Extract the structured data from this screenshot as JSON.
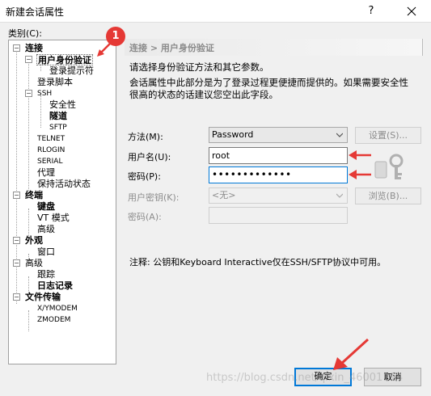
{
  "window": {
    "title": "新建会话属性",
    "help_glyph": "?",
    "close_glyph": "✕"
  },
  "category_label": "类别(C):",
  "tree": [
    {
      "id": "conn",
      "label": "连接",
      "bold": true
    },
    {
      "id": "auth",
      "label": "用户身份验证",
      "bold": true
    },
    {
      "id": "login-prompt",
      "label": "登录提示符"
    },
    {
      "id": "login-script",
      "label": "登录脚本"
    },
    {
      "id": "ssh",
      "label": "SSH"
    },
    {
      "id": "security",
      "label": "安全性"
    },
    {
      "id": "tunnel",
      "label": "隧道",
      "bold": true
    },
    {
      "id": "sftp",
      "label": "SFTP"
    },
    {
      "id": "telnet",
      "label": "TELNET"
    },
    {
      "id": "rlogin",
      "label": "RLOGIN"
    },
    {
      "id": "serial",
      "label": "SERIAL"
    },
    {
      "id": "proxy",
      "label": "代理"
    },
    {
      "id": "keepalive",
      "label": "保持活动状态"
    },
    {
      "id": "terminal",
      "label": "终端",
      "bold": true
    },
    {
      "id": "keyboard",
      "label": "键盘",
      "bold": true
    },
    {
      "id": "vt-mode",
      "label": "VT 模式"
    },
    {
      "id": "term-advanced",
      "label": "高级"
    },
    {
      "id": "appearance",
      "label": "外观",
      "bold": true
    },
    {
      "id": "window",
      "label": "窗口"
    },
    {
      "id": "advanced",
      "label": "高级"
    },
    {
      "id": "trace",
      "label": "跟踪"
    },
    {
      "id": "logging",
      "label": "日志记录",
      "bold": true
    },
    {
      "id": "file-transfer",
      "label": "文件传输",
      "bold": true
    },
    {
      "id": "xymodem",
      "label": "X/YMODEM"
    },
    {
      "id": "zmodem",
      "label": "ZMODEM"
    }
  ],
  "panel": {
    "breadcrumb": "连接 > 用户身份验证",
    "desc1": "请选择身份验证方法和其它参数。",
    "desc2_line1": "会话属性中此部分是为了登录过程更便捷而提供的。如果需要安全性",
    "desc2_line2": "很高的状态的话建议您空出此字段。",
    "method_label": "方法(M):",
    "method_value": "Password",
    "settings_button": "设置(S)...",
    "username_label": "用户名(U):",
    "username_value": "root",
    "password_label": "密码(P):",
    "password_value": "•••••••••••••",
    "userkey_label": "用户密钥(K):",
    "userkey_value": "<无>",
    "browse_button": "浏览(B)...",
    "passphrase_label": "密码(A):",
    "note": "注释: 公钥和Keyboard Interactive仅在SSH/SFTP协议中可用。"
  },
  "buttons": {
    "ok": "确定",
    "cancel": "取消"
  },
  "annotation": {
    "badge": "1"
  },
  "watermark": "https://blog.csdn.net/qixin_46001114",
  "colors": {
    "accent": "#0078d7",
    "arrow": "#e53935"
  }
}
